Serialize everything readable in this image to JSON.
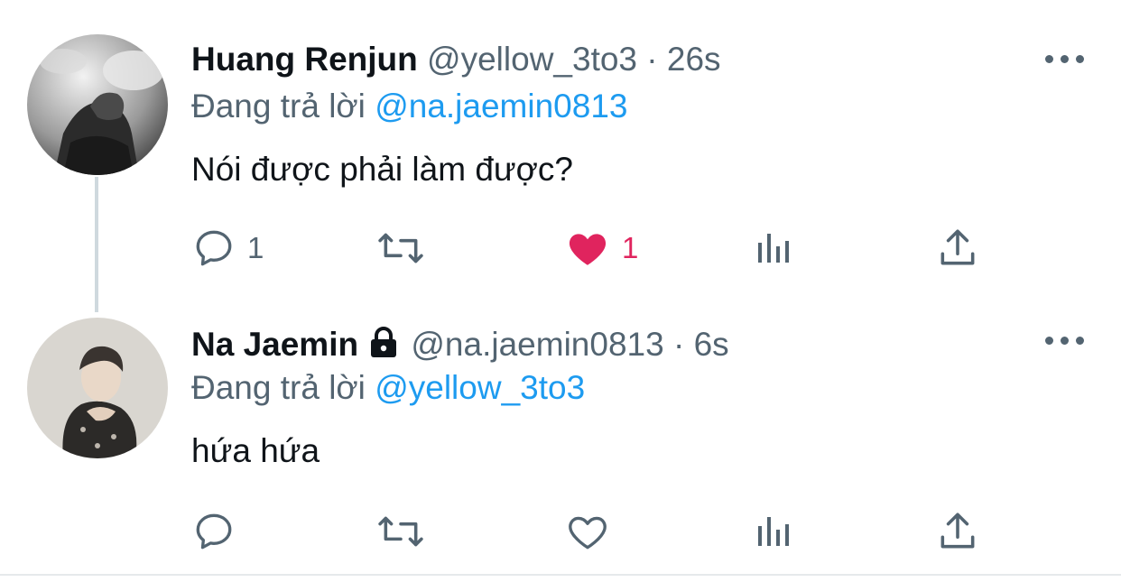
{
  "tweets": [
    {
      "name": "Huang Renjun",
      "handle": "@yellow_3to3",
      "separator": "·",
      "time": "26s",
      "replying_prefix": "Đang trả lời",
      "replying_to": "@na.jaemin0813",
      "text": "Nói được phải làm được?",
      "reply_count": "1",
      "retweet_count": "",
      "like_count": "1",
      "liked": true,
      "locked": false
    },
    {
      "name": "Na Jaemin",
      "handle": "@na.jaemin0813",
      "separator": "·",
      "time": "6s",
      "replying_prefix": "Đang trả lời",
      "replying_to": "@yellow_3to3",
      "text": "hứa hứa",
      "reply_count": "",
      "retweet_count": "",
      "like_count": "",
      "liked": false,
      "locked": true
    }
  ],
  "colors": {
    "text": "#0f1419",
    "secondary": "#536471",
    "link": "#1d9bf0",
    "like": "#e0245e",
    "thread_line": "#cfd9de"
  },
  "icons": [
    "reply-icon",
    "retweet-icon",
    "heart-icon",
    "analytics-icon",
    "share-icon",
    "more-icon",
    "lock-icon"
  ]
}
